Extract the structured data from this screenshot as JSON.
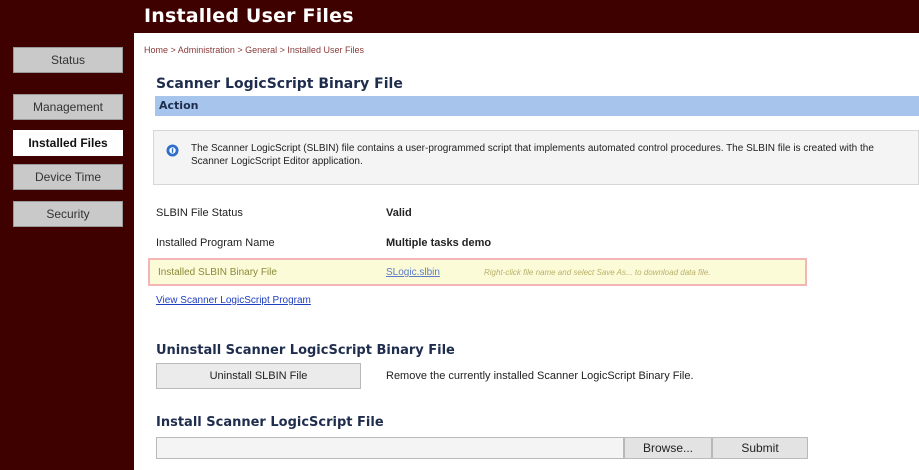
{
  "header": {
    "title": "Installed User Files"
  },
  "sidebar": {
    "items": [
      {
        "label": "Status",
        "active": false
      },
      {
        "label": "Management",
        "active": false
      },
      {
        "label": "Installed Files",
        "active": true
      },
      {
        "label": "Device Time",
        "active": false
      },
      {
        "label": "Security",
        "active": false
      }
    ]
  },
  "breadcrumb": {
    "items": [
      "Home",
      "Administration",
      "General",
      "Installed User Files"
    ],
    "separator": ">"
  },
  "page": {
    "title": "Scanner LogicScript Binary File",
    "action_label": "Action",
    "info_icon": "info-icon",
    "info_text": "The Scanner LogicScript (SLBIN) file contains a user-programmed script that implements automated control procedures. The SLBIN file is created with the Scanner LogicScript Editor application."
  },
  "details": {
    "status_label": "SLBIN File Status",
    "status_value": "Valid",
    "program_label": "Installed Program Name",
    "program_value": "Multiple tasks demo",
    "binary_label": "Installed SLBIN Binary File",
    "binary_link": "SLogic.slbin",
    "binary_hint": "Right-click file name and select Save As... to download data file.",
    "view_link": "View Scanner LogicScript Program"
  },
  "uninstall": {
    "title": "Uninstall Scanner LogicScript Binary File",
    "button_label": "Uninstall SLBIN File",
    "description": "Remove the currently installed Scanner LogicScript Binary File."
  },
  "install": {
    "title": "Install Scanner LogicScript File",
    "file_value": "",
    "browse_label": "Browse...",
    "submit_label": "Submit"
  },
  "colors": {
    "brand": "#3f0000",
    "action_bar": "#a6c4ec",
    "highlight_bg": "#fcfbd8",
    "highlight_border": "#f3b5b5",
    "link": "#1f3fbf"
  }
}
